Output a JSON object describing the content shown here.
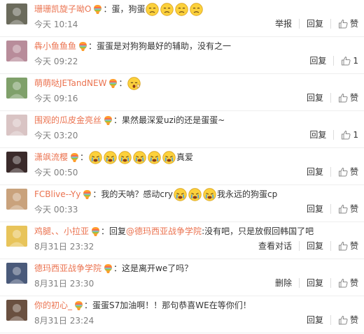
{
  "comments": [
    {
      "user": "珊珊凯旋子呦O",
      "sep": "：",
      "text_before": "蛋，狗蛋",
      "emojis": [
        "sad-face",
        "sad-face",
        "sad-face",
        "sad-face"
      ],
      "text_after": "",
      "time": "今天 10:14",
      "actions": [
        "举报",
        "回复"
      ],
      "like_label": "赞",
      "avatar_color": "#6b6b5c"
    },
    {
      "user": "犇小鱼鱼鱼",
      "sep": "：",
      "text_before": "蛋蛋是对狗狗最好的辅助，没有之一",
      "emojis": [],
      "text_after": "",
      "time": "今天 09:22",
      "actions": [
        "回复"
      ],
      "like_label": "1",
      "avatar_color": "#b88c9a"
    },
    {
      "user": "萌萌哒JETandNEW",
      "sep": "：",
      "text_before": "",
      "emojis": [
        "yawn-face"
      ],
      "text_after": "",
      "time": "今天 09:16",
      "actions": [
        "回复"
      ],
      "like_label": "赞",
      "avatar_color": "#7fa06a"
    },
    {
      "user": "围观的瓜皮金亮丝",
      "sep": "：",
      "text_before": "果然最深爱uzi的还是蛋蛋~",
      "emojis": [],
      "text_after": "",
      "time": "今天 03:20",
      "actions": [
        "回复"
      ],
      "like_label": "1",
      "avatar_color": "#d9c4c4"
    },
    {
      "user": "潇飒流樱",
      "sep": "：",
      "text_before": "",
      "emojis": [
        "cry-face",
        "cry-face",
        "cry-face",
        "cry-face",
        "cry-face",
        "cry-face"
      ],
      "text_after": "真爱",
      "time": "今天 00:50",
      "actions": [
        "回复"
      ],
      "like_label": "赞",
      "avatar_color": "#3a2a2a"
    },
    {
      "user": "FCBlive--Yy",
      "sep": "：",
      "text_before": "我的天呐？感动cry",
      "emojis": [
        "cry-face",
        "cry-face",
        "cry-face"
      ],
      "text_after": "我永远的狗蛋cp",
      "time": "今天 00:33",
      "actions": [
        "回复"
      ],
      "like_label": "赞",
      "avatar_color": "#c9a27c"
    },
    {
      "user": "鸡腿、、小拉亚",
      "sep": "：",
      "text_before": "回复",
      "mention": "@德玛西亚战争学院",
      "text_after": ":没有吧，只是放假回韩国了吧",
      "emojis": [],
      "time": "8月31日 23:32",
      "actions": [
        "查看对话",
        "回复"
      ],
      "like_label": "赞",
      "avatar_color": "#e8c45a"
    },
    {
      "user": "德玛西亚战争学院",
      "sep": "：",
      "text_before": "这是离开we了吗？",
      "emojis": [],
      "text_after": "",
      "time": "8月31日 23:30",
      "actions": [
        "删除",
        "回复"
      ],
      "like_label": "赞",
      "avatar_color": "#4a5a7a"
    },
    {
      "user": "你的初心_",
      "sep": "：",
      "text_before": "蛋蛋S7加油啊！！那句恭喜WE在等你们！",
      "emojis": [],
      "text_after": "",
      "time": "8月31日 23:24",
      "actions": [
        "回复"
      ],
      "like_label": "赞",
      "avatar_color": "#6a5040"
    }
  ]
}
